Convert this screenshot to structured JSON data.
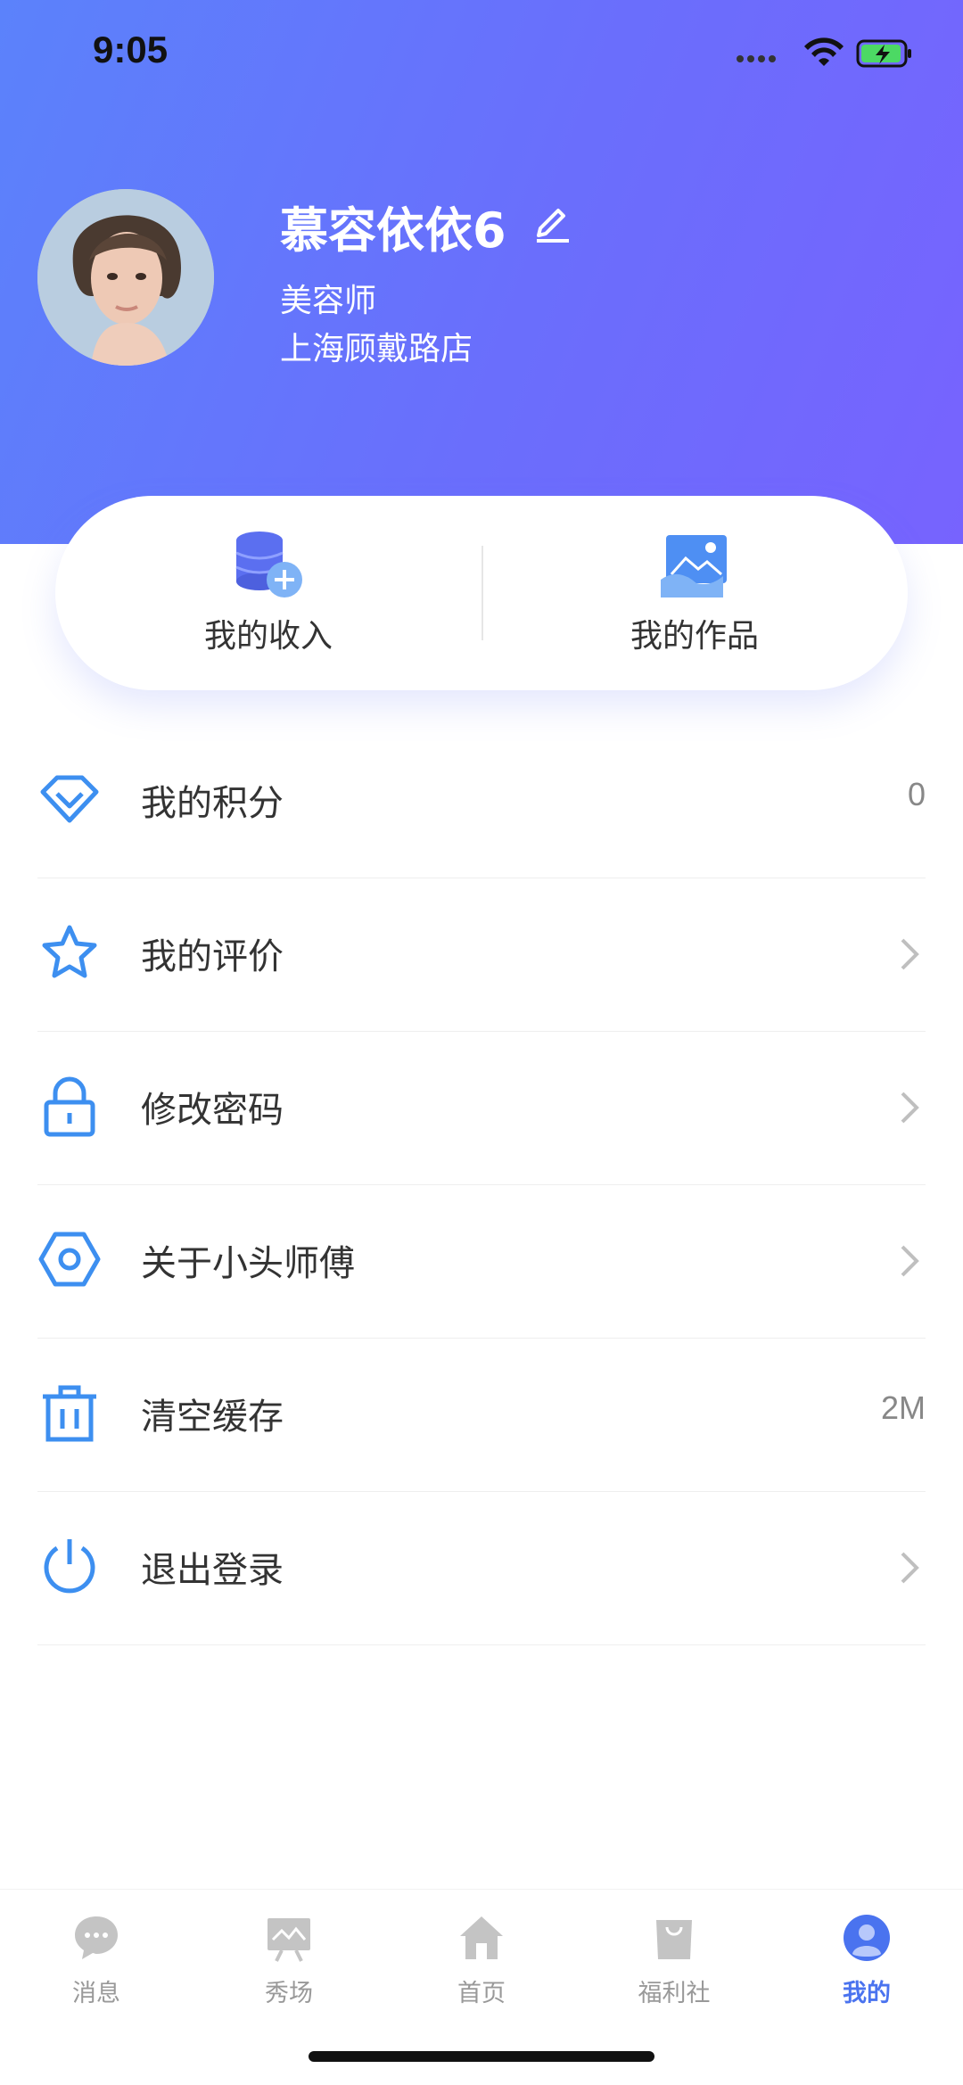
{
  "status_bar": {
    "time": "9:05"
  },
  "profile": {
    "name": "慕容依依6",
    "role": "美容师",
    "store": "上海顾戴路店"
  },
  "quick_actions": [
    {
      "label": "我的收入",
      "icon": "coins-plus-icon"
    },
    {
      "label": "我的作品",
      "icon": "image-hand-icon"
    }
  ],
  "menu": [
    {
      "label": "我的积分",
      "icon": "diamond-icon",
      "value": "0"
    },
    {
      "label": "我的评价",
      "icon": "star-icon"
    },
    {
      "label": "修改密码",
      "icon": "lock-icon"
    },
    {
      "label": "关于小头师傅",
      "icon": "hexagon-icon"
    },
    {
      "label": "清空缓存",
      "icon": "trash-icon",
      "value": "2M"
    },
    {
      "label": "退出登录",
      "icon": "power-icon"
    }
  ],
  "tabbar": [
    {
      "label": "消息",
      "icon": "chat-icon",
      "active": false
    },
    {
      "label": "秀场",
      "icon": "showcase-icon",
      "active": false
    },
    {
      "label": "首页",
      "icon": "home-icon",
      "active": false
    },
    {
      "label": "福利社",
      "icon": "bag-icon",
      "active": false
    },
    {
      "label": "我的",
      "icon": "user-icon",
      "active": true
    }
  ],
  "colors": {
    "accent": "#4a73ef",
    "icon_blue": "#3d8ff0",
    "header_start": "#5b82fb",
    "header_end": "#7763fe",
    "tab_inactive": "#c4c4c4"
  }
}
